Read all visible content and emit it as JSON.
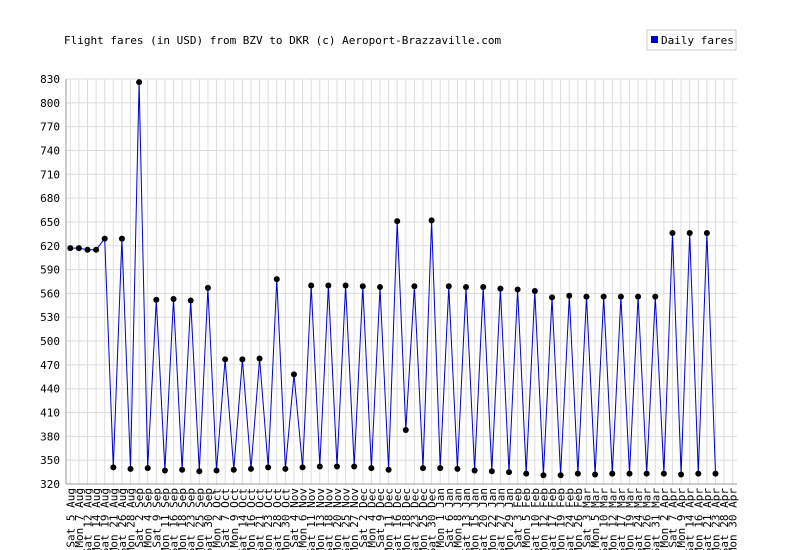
{
  "chart_data": {
    "type": "line",
    "title": "Flight fares (in USD) from BZV to DKR (c) Aeroport-Brazzaville.com",
    "legend": {
      "label": "Daily fares",
      "placement": "top-right"
    },
    "ylim": [
      320,
      830
    ],
    "yticks": [
      320,
      350,
      380,
      410,
      440,
      470,
      500,
      530,
      560,
      590,
      620,
      650,
      680,
      710,
      740,
      770,
      800,
      830
    ],
    "grid": true,
    "colors": {
      "line": "#0000cc",
      "marker": "#000000",
      "grid": "#dddddd",
      "axis": "#999999"
    },
    "x_labels": [
      "Sat 5 Aug",
      "Mon 7 Aug",
      "Sat 12 Aug",
      "Mon 14 Aug",
      "Sat 19 Aug",
      "Mon 21 Aug",
      "Sat 26 Aug",
      "Mon 28 Aug",
      "Sat 2 Sep",
      "Mon 4 Sep",
      "Sat 9 Sep",
      "Mon 11 Sep",
      "Sat 16 Sep",
      "Mon 18 Sep",
      "Sat 23 Sep",
      "Mon 25 Sep",
      "Sat 30 Sep",
      "Mon 2 Oct",
      "Sat 7 Oct",
      "Mon 9 Oct",
      "Sat 14 Oct",
      "Mon 16 Oct",
      "Sat 21 Oct",
      "Mon 23 Oct",
      "Sat 28 Oct",
      "Mon 30 Oct",
      "Sat 4 Nov",
      "Mon 6 Nov",
      "Sat 11 Nov",
      "Mon 13 Nov",
      "Sat 18 Nov",
      "Mon 20 Nov",
      "Sat 25 Nov",
      "Mon 27 Nov",
      "Sat 2 Dec",
      "Mon 4 Dec",
      "Sat 9 Dec",
      "Mon 11 Dec",
      "Sat 16 Dec",
      "Mon 18 Dec",
      "Sat 23 Dec",
      "Mon 25 Dec",
      "Sat 30 Dec",
      "Mon 1 Jan",
      "Sat 6 Jan",
      "Mon 8 Jan",
      "Sat 13 Jan",
      "Mon 15 Jan",
      "Sat 20 Jan",
      "Mon 22 Jan",
      "Sat 27 Jan",
      "Mon 29 Jan",
      "Sat 3 Feb",
      "Mon 5 Feb",
      "Sat 10 Feb",
      "Mon 12 Feb",
      "Sat 17 Feb",
      "Mon 19 Feb",
      "Sat 24 Feb",
      "Mon 26 Feb",
      "Sat 3 Mar",
      "Mon 5 Mar",
      "Sat 10 Mar",
      "Mon 12 Mar",
      "Sat 17 Mar",
      "Mon 19 Mar",
      "Sat 24 Mar",
      "Mon 26 Mar",
      "Sat 31 Mar",
      "Mon 2 Apr",
      "Sat 7 Apr",
      "Mon 9 Apr",
      "Sat 14 Apr",
      "Mon 16 Apr",
      "Sat 21 Apr",
      "Mon 23 Apr",
      "Sat 28 Apr",
      "Mon 30 Apr"
    ],
    "series": [
      {
        "name": "Daily fares",
        "values": [
          617,
          617,
          615,
          615,
          629,
          341,
          629,
          339,
          826,
          340,
          552,
          337,
          553,
          338,
          551,
          336,
          567,
          337,
          477,
          338,
          477,
          339,
          478,
          341,
          578,
          339,
          458,
          341,
          570,
          342,
          570,
          342,
          570,
          342,
          569,
          340,
          568,
          338,
          651,
          388,
          569,
          340,
          652,
          340,
          569,
          339,
          568,
          337,
          568,
          336,
          566,
          335,
          565,
          333,
          563,
          331,
          555,
          331,
          557,
          333,
          556,
          332,
          556,
          333,
          556,
          333,
          556,
          333,
          556,
          333,
          636,
          332,
          636,
          333,
          636,
          333
        ]
      }
    ]
  }
}
